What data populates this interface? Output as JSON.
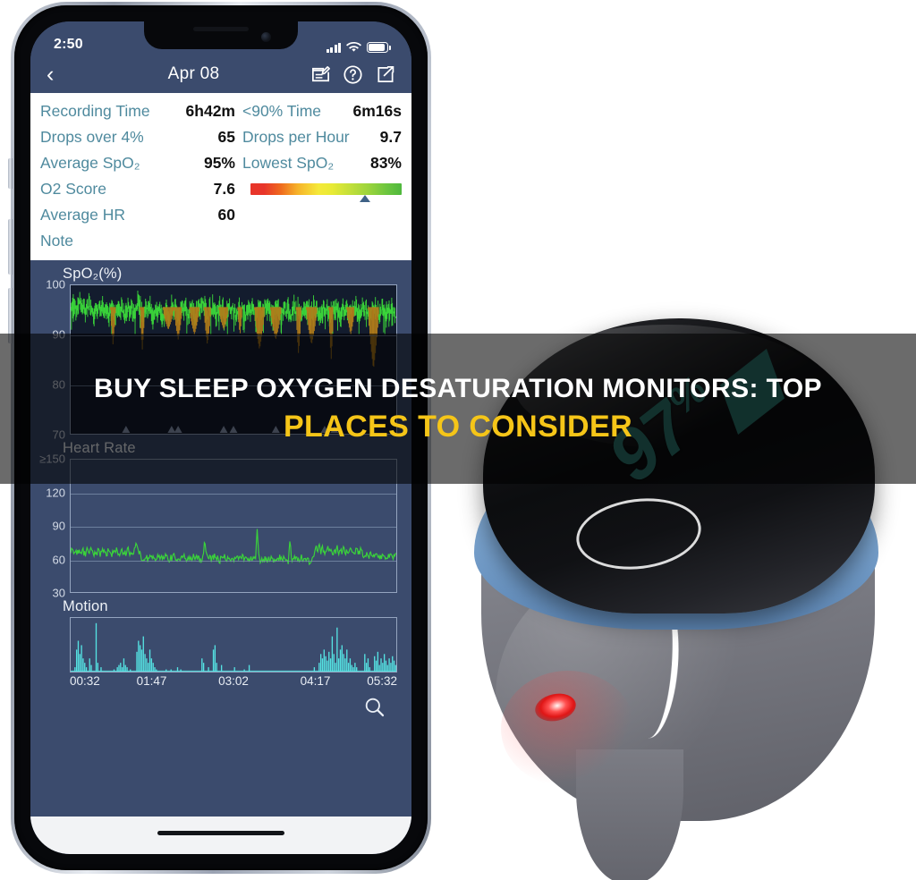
{
  "banner": {
    "line1": "BUY SLEEP OXYGEN DESATURATION MONITORS: TOP",
    "line2": "PLACES TO CONSIDER",
    "line1_color": "#ffffff",
    "line2_color": "#f5c518",
    "scrim_color": "rgba(0,0,0,0.58)"
  },
  "phone": {
    "status_bar": {
      "time": "2:50",
      "signal_icon": "cellular-bars-icon",
      "wifi_icon": "wifi-icon",
      "battery_icon": "battery-icon"
    },
    "nav_bar": {
      "back_icon": "chevron-left-icon",
      "title": "Apr 08",
      "edit_icon": "edit-note-icon",
      "help_icon": "question-circle-icon",
      "share_icon": "share-square-icon"
    },
    "stats": {
      "rows": [
        {
          "label_left": "Recording Time",
          "value_left": "6h42m",
          "label_right": "<90% Time",
          "value_right": "6m16s"
        },
        {
          "label_left": "Drops over 4%",
          "value_left": "65",
          "label_right": "Drops per Hour",
          "value_right": "9.7"
        },
        {
          "label_left": "Average SpO₂",
          "value_left": "95%",
          "label_right": "Lowest SpO₂",
          "value_right": "83%"
        },
        {
          "label_left": "O2 Score",
          "value_left": "7.6",
          "label_right": "o2-score-gradient-bar",
          "value_right": ""
        },
        {
          "label_left": "Average HR",
          "value_left": "60",
          "label_right": "",
          "value_right": ""
        },
        {
          "label_left": "Note",
          "value_left": "",
          "label_right": "",
          "value_right": ""
        }
      ],
      "o2_score_marker_percent": "76",
      "label_color": "#4f8a9e",
      "value_color": "#111111"
    },
    "search_icon": "magnifier-icon",
    "home_indicator": "home-indicator"
  },
  "device": {
    "display_value": "97",
    "display_unit": "%",
    "display_color": "#2e7d74",
    "led_label": "red-sensor-led",
    "button_label": "power-button"
  },
  "chart_data": [
    {
      "type": "line",
      "title": "SpO₂(%)",
      "ylabel": "SpO₂(%)",
      "xlabel": "",
      "ylim": [
        70,
        100
      ],
      "yticks": [
        100,
        90,
        80,
        70
      ],
      "grid": true,
      "legend": "none",
      "series": [
        {
          "name": "SpO2",
          "color": "#3ad43a",
          "desat_color": "#b07b1a",
          "values": [
            96,
            97,
            96,
            95,
            96,
            97,
            96,
            95,
            96,
            95,
            96,
            97,
            96,
            95,
            94,
            96,
            95,
            96,
            95,
            96,
            95,
            96,
            95,
            94,
            95,
            96,
            95,
            94,
            95,
            96,
            95,
            96,
            95,
            94,
            95,
            96,
            95,
            96,
            95,
            94,
            96,
            97,
            96,
            95,
            94,
            95,
            96,
            95,
            96,
            95,
            94,
            95,
            96,
            95,
            96,
            95,
            94,
            95,
            96,
            95,
            94,
            95,
            96,
            95,
            96,
            95,
            94,
            95,
            96,
            95,
            96,
            95,
            94,
            95,
            96,
            95,
            94,
            95,
            96,
            95,
            96,
            97,
            96,
            95,
            94,
            96,
            95,
            96,
            95,
            94,
            95,
            96,
            95,
            96,
            95,
            94,
            95,
            96,
            95,
            96,
            95,
            94,
            95,
            96,
            95,
            96,
            95,
            94,
            95,
            96,
            95,
            96,
            95,
            94,
            95,
            96,
            95,
            94,
            95,
            96,
            95,
            96,
            95,
            94,
            95,
            96,
            95,
            96,
            95,
            94,
            95,
            96,
            95,
            96,
            95,
            94,
            95,
            96,
            95,
            96,
            95,
            94,
            95,
            96,
            95,
            96,
            95,
            94,
            95,
            96,
            95,
            96,
            95,
            94,
            95,
            96,
            95,
            96,
            95,
            94,
            95,
            96,
            95,
            96,
            95,
            94,
            95,
            96,
            95,
            96,
            95,
            94,
            95,
            96,
            95,
            96,
            95,
            94,
            95,
            96,
            95,
            96,
            95,
            94,
            95,
            96,
            95,
            96,
            95,
            94,
            95,
            96,
            95,
            94,
            95,
            96,
            95,
            96,
            95,
            94
          ]
        }
      ],
      "desat_dip_minima": [
        88,
        87,
        91,
        89,
        90,
        88,
        91,
        90,
        87,
        89,
        86,
        88,
        85,
        90,
        83
      ],
      "marker_glyph": "event-triangle-marker",
      "marker_count": 8
    },
    {
      "type": "line",
      "title": "Heart Rate",
      "ylabel": "Heart Rate",
      "xlabel": "",
      "ylim": [
        30,
        150
      ],
      "yticks": [
        "≥150",
        "120",
        "90",
        "60",
        "30"
      ],
      "grid": true,
      "legend": "none",
      "series": [
        {
          "name": "HR",
          "color": "#3ad43a",
          "values": [
            66,
            68,
            64,
            70,
            65,
            67,
            63,
            69,
            66,
            64,
            68,
            65,
            70,
            66,
            63,
            67,
            65,
            69,
            64,
            66,
            68,
            65,
            63,
            70,
            66,
            64,
            67,
            65,
            69,
            66,
            63,
            68,
            65,
            67,
            64,
            70,
            66,
            63,
            65,
            68,
            76,
            70,
            66,
            62,
            58,
            60,
            63,
            59,
            61,
            64,
            60,
            62,
            58,
            61,
            63,
            59,
            62,
            60,
            64,
            61,
            59,
            62,
            60,
            63,
            61,
            59,
            62,
            60,
            61,
            63,
            59,
            60,
            62,
            61,
            59,
            62,
            60,
            63,
            61,
            59,
            60,
            62,
            78,
            64,
            60,
            62,
            59,
            61,
            63,
            60,
            62,
            58,
            61,
            60,
            63,
            59,
            61,
            62,
            60,
            58,
            61,
            59,
            62,
            60,
            61,
            63,
            59,
            60,
            62,
            58,
            61,
            59,
            62,
            60,
            88,
            62,
            58,
            60,
            59,
            61,
            58,
            60,
            59,
            62,
            58,
            60,
            61,
            59,
            62,
            58,
            60,
            59,
            61,
            58,
            76,
            60,
            58,
            61,
            59,
            60,
            58,
            62,
            59,
            61,
            58,
            60,
            55,
            58,
            62,
            66,
            70,
            68,
            72,
            66,
            70,
            64,
            68,
            72,
            66,
            70,
            64,
            68,
            66,
            70,
            64,
            68,
            66,
            72,
            64,
            68,
            66,
            70,
            64,
            68,
            66,
            70,
            64,
            68,
            66,
            62,
            64,
            66,
            62,
            64,
            66,
            62,
            64,
            66,
            62,
            60,
            62,
            64,
            62,
            60,
            62,
            64,
            62,
            60,
            62,
            64
          ]
        }
      ],
      "peaks": [
        88,
        78,
        76,
        76
      ]
    },
    {
      "type": "bar",
      "title": "Motion",
      "ylabel": "",
      "xlabel": "",
      "grid": false,
      "legend": "none",
      "series": [
        {
          "name": "Motion",
          "color": "#55e3e3",
          "values": [
            0,
            0,
            2,
            10,
            14,
            8,
            12,
            6,
            4,
            2,
            0,
            6,
            3,
            0,
            0,
            22,
            4,
            0,
            2,
            0,
            0,
            0,
            0,
            0,
            0,
            0,
            1,
            0,
            2,
            3,
            4,
            2,
            6,
            3,
            2,
            0,
            1,
            0,
            0,
            0,
            9,
            14,
            12,
            10,
            16,
            8,
            6,
            4,
            10,
            6,
            4,
            2,
            1,
            0,
            0,
            0,
            0,
            0,
            1,
            0,
            0,
            1,
            0,
            0,
            0,
            2,
            0,
            1,
            0,
            0,
            0,
            0,
            0,
            0,
            0,
            0,
            0,
            0,
            0,
            0,
            6,
            4,
            0,
            0,
            2,
            0,
            0,
            10,
            12,
            4,
            0,
            0,
            3,
            0,
            0,
            0,
            0,
            0,
            0,
            0,
            2,
            0,
            0,
            0,
            0,
            0,
            1,
            0,
            0,
            3,
            0,
            0,
            0,
            0,
            0,
            0,
            0,
            0,
            0,
            0,
            0,
            0,
            0,
            0,
            0,
            0,
            0,
            0,
            0,
            0,
            0,
            0,
            0,
            0,
            0,
            0,
            0,
            0,
            0,
            0,
            0,
            0,
            0,
            0,
            0,
            0,
            0,
            0,
            0,
            2,
            0,
            0,
            4,
            8,
            6,
            10,
            7,
            5,
            9,
            6,
            16,
            8,
            4,
            20,
            6,
            10,
            12,
            8,
            6,
            10,
            4,
            6,
            3,
            2,
            4,
            2,
            0,
            0,
            0,
            0,
            8,
            4,
            6,
            2,
            0,
            0,
            7,
            5,
            9,
            3,
            6,
            4,
            8,
            5,
            3,
            6,
            4,
            7,
            5,
            3
          ]
        }
      ],
      "xticks": [
        "00:32",
        "01:47",
        "03:02",
        "04:17",
        "05:32"
      ]
    }
  ]
}
